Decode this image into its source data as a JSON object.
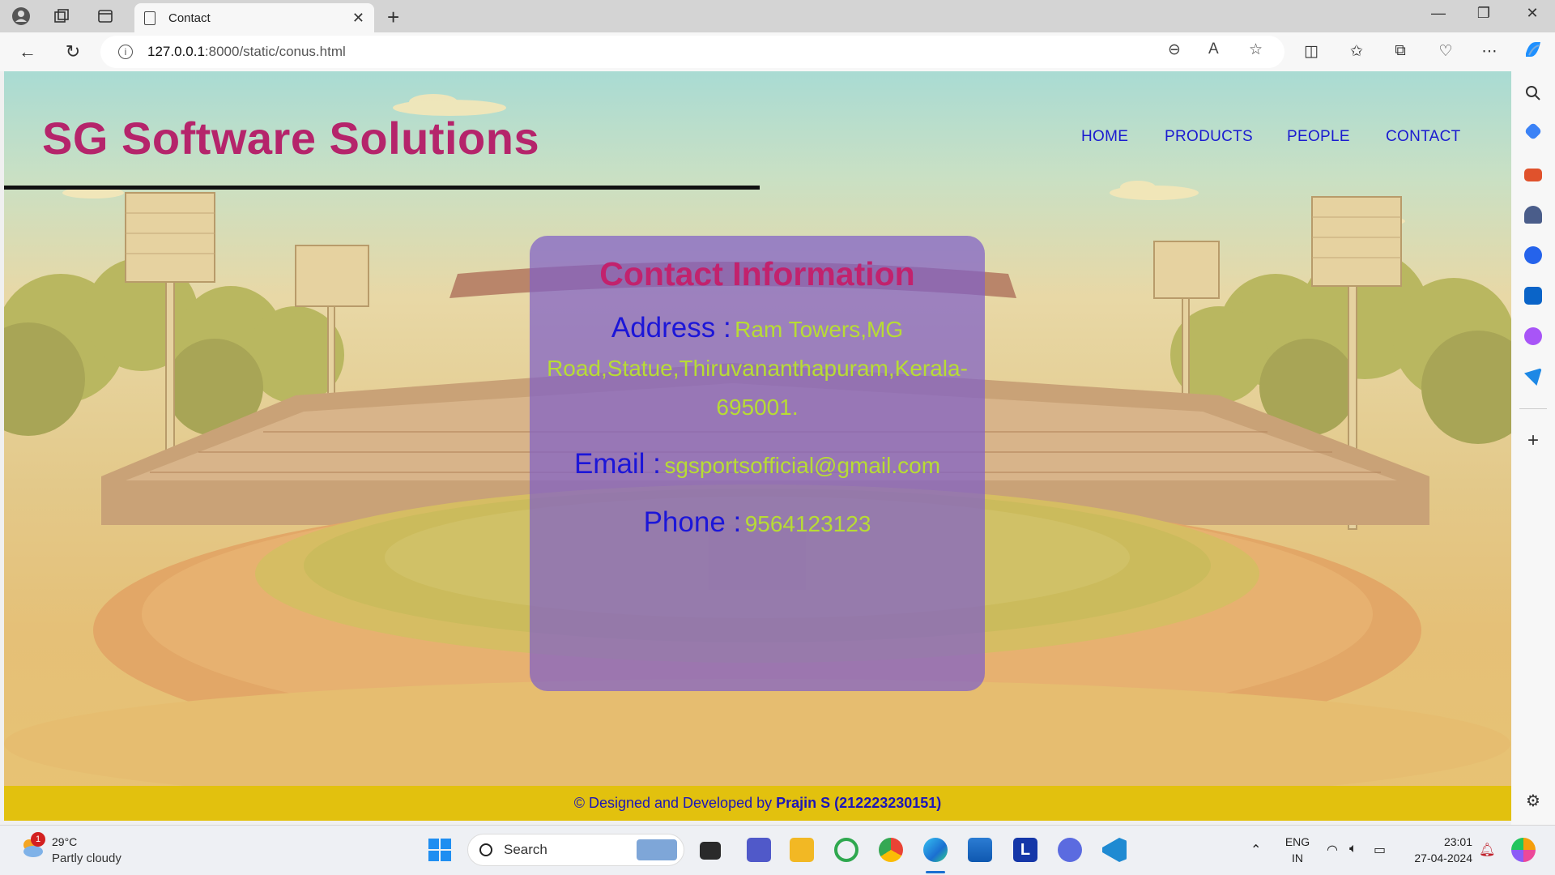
{
  "browser": {
    "tab_title": "Contact",
    "url_host": "127.0.0.1",
    "url_rest": ":8000/static/conus.html"
  },
  "site": {
    "title": "SG Software Solutions",
    "nav": [
      {
        "label": "HOME"
      },
      {
        "label": "PRODUCTS"
      },
      {
        "label": "PEOPLE"
      },
      {
        "label": "CONTACT"
      }
    ]
  },
  "contact": {
    "heading": "Contact Information",
    "address_label": "Address :",
    "address_value": "Ram Towers,MG Road,Statue,Thiruvananthapuram,Kerala-695001.",
    "email_label": "Email :",
    "email_value": "sgsportsofficial@gmail.com",
    "phone_label": "Phone :",
    "phone_value": "9564123123"
  },
  "footer": {
    "prefix": "© Designed and Developed by ",
    "author": "Prajin S (212223230151)"
  },
  "taskbar": {
    "weather_temp": "29°C",
    "weather_desc": "Partly cloudy",
    "weather_badge": "1",
    "search_placeholder": "Search",
    "lang_1": "ENG",
    "lang_2": "IN",
    "time": "23:01",
    "date": "27-04-2024"
  },
  "colors": {
    "title": "#b5246b",
    "nav": "#1a1ad0",
    "card": "#8060c8",
    "label": "#1c16d8",
    "value": "#b8dc34",
    "footer_bg": "#e2c10e"
  }
}
